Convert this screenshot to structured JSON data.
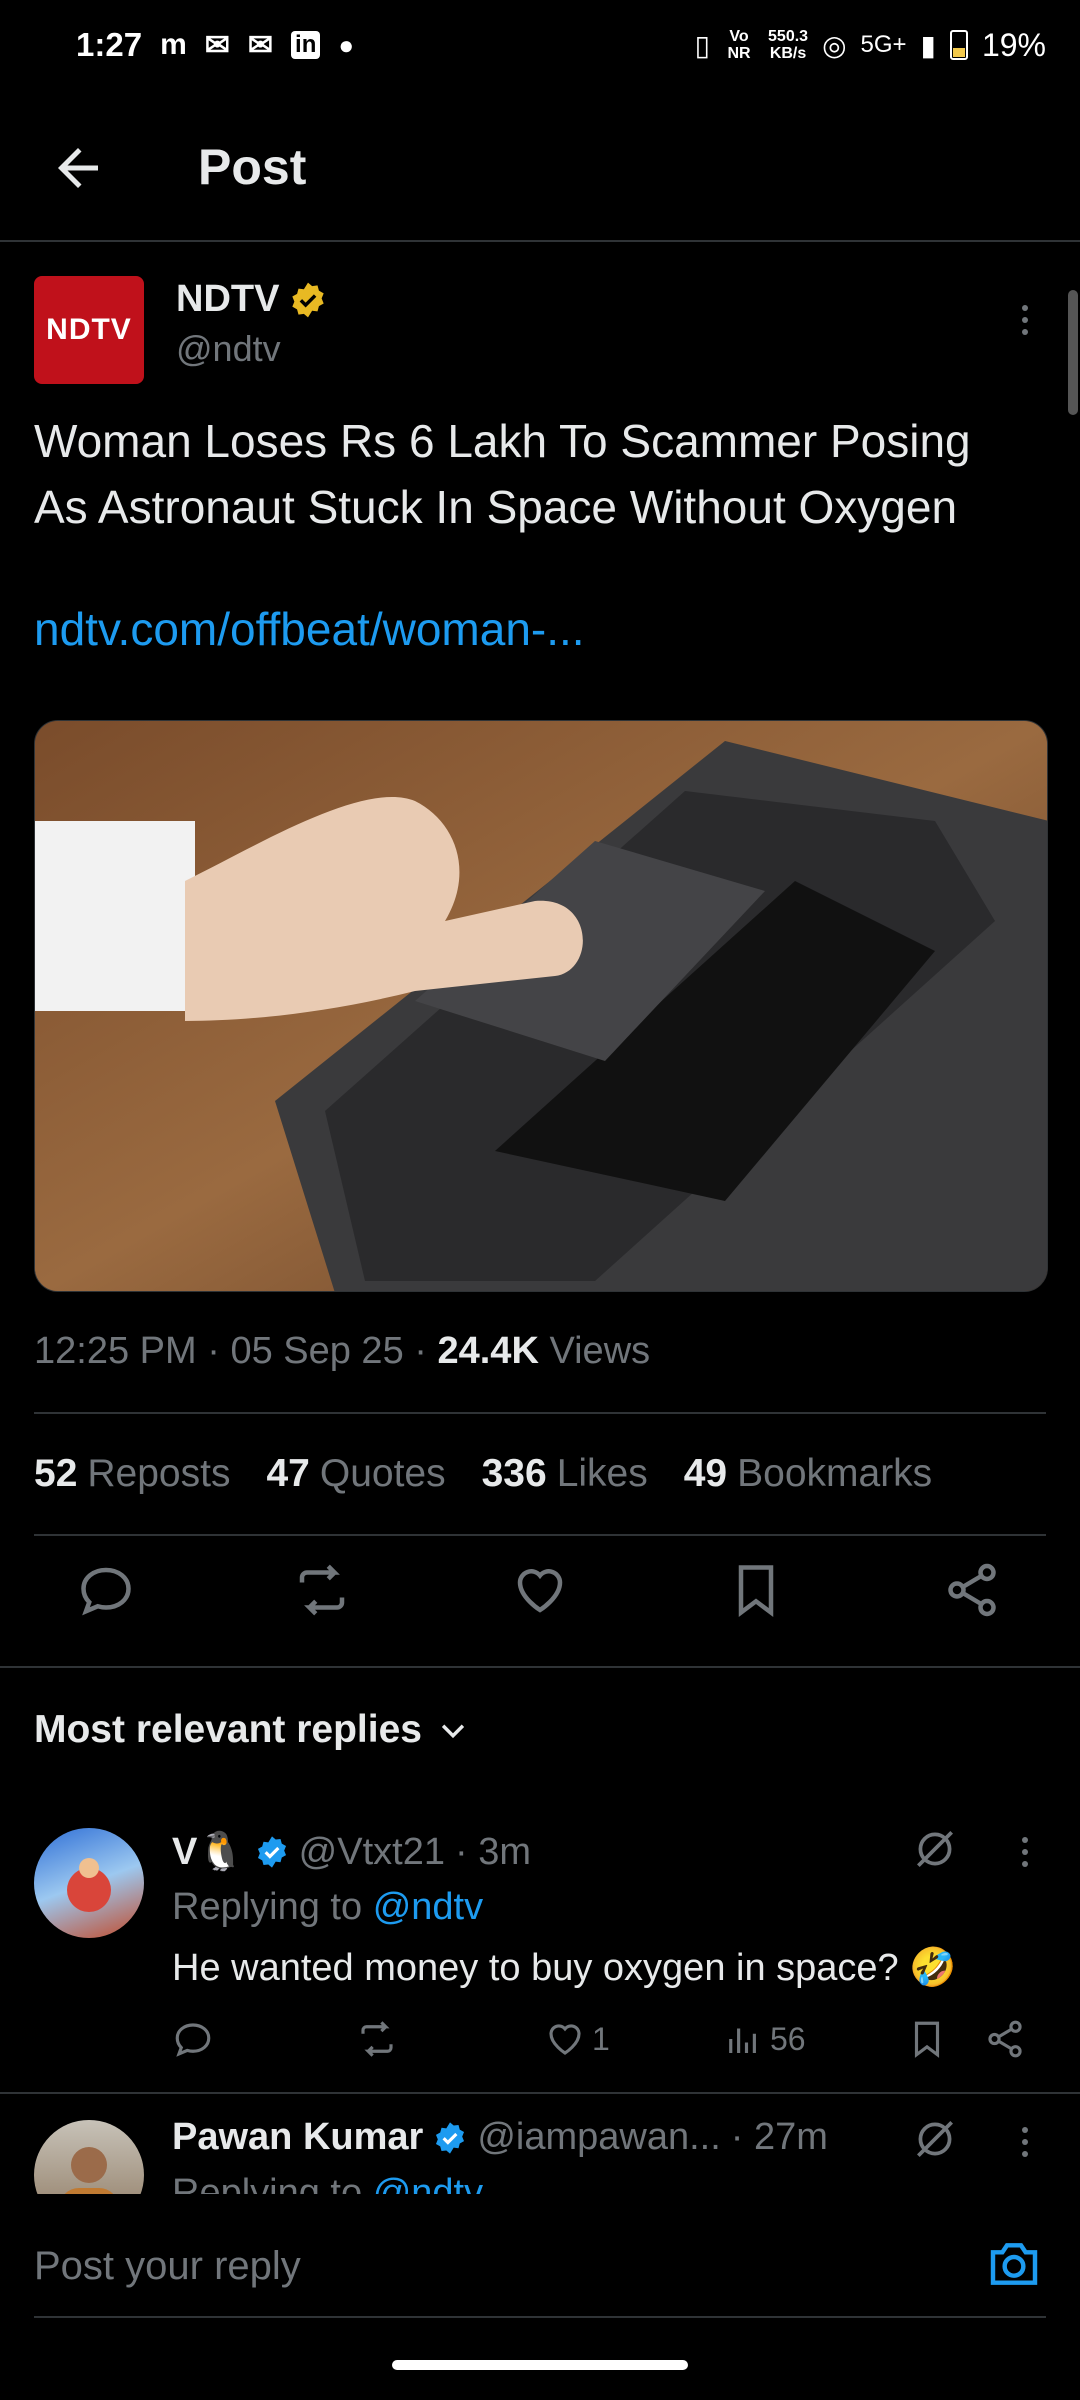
{
  "status_bar": {
    "time": "1:27",
    "network_speed_value": "550.3",
    "network_speed_unit": "KB/s",
    "network_type": "5G+",
    "battery": "19%",
    "vo_nr": "Vo NR"
  },
  "header": {
    "title": "Post"
  },
  "post": {
    "author_name": "NDTV",
    "author_handle": "@ndtv",
    "avatar_logo": "NDTV",
    "text": "Woman Loses Rs 6 Lakh To Scammer Posing As Astronaut Stuck In Space Without Oxygen",
    "link": "ndtv.com/offbeat/woman-...",
    "time": "12:25 PM",
    "date": "05 Sep 25",
    "views_count": "24.4K",
    "views_label": "Views",
    "stats": [
      {
        "count": "52",
        "label": "Reposts"
      },
      {
        "count": "47",
        "label": "Quotes"
      },
      {
        "count": "336",
        "label": "Likes"
      },
      {
        "count": "49",
        "label": "Bookmarks"
      }
    ]
  },
  "replies_section": {
    "title": "Most relevant replies"
  },
  "replies": [
    {
      "name": "V🐧",
      "handle": "@Vtxt21",
      "time": "· 3m",
      "replying_prefix": "Replying to",
      "replying_to": "@ndtv",
      "text": "He wanted money to buy oxygen in space? 🤣",
      "likes": "1",
      "views": "56"
    },
    {
      "name": "Pawan Kumar",
      "handle": "@iampawan...",
      "time": "· 27m",
      "replying_prefix": "Replying to",
      "replying_to": "@ndtv"
    }
  ],
  "reply_bar": {
    "placeholder": "Post your reply"
  },
  "colors": {
    "accent": "#1d9bf0",
    "verified_gold": "#e8b923",
    "verified_blue": "#1d9bf0"
  }
}
